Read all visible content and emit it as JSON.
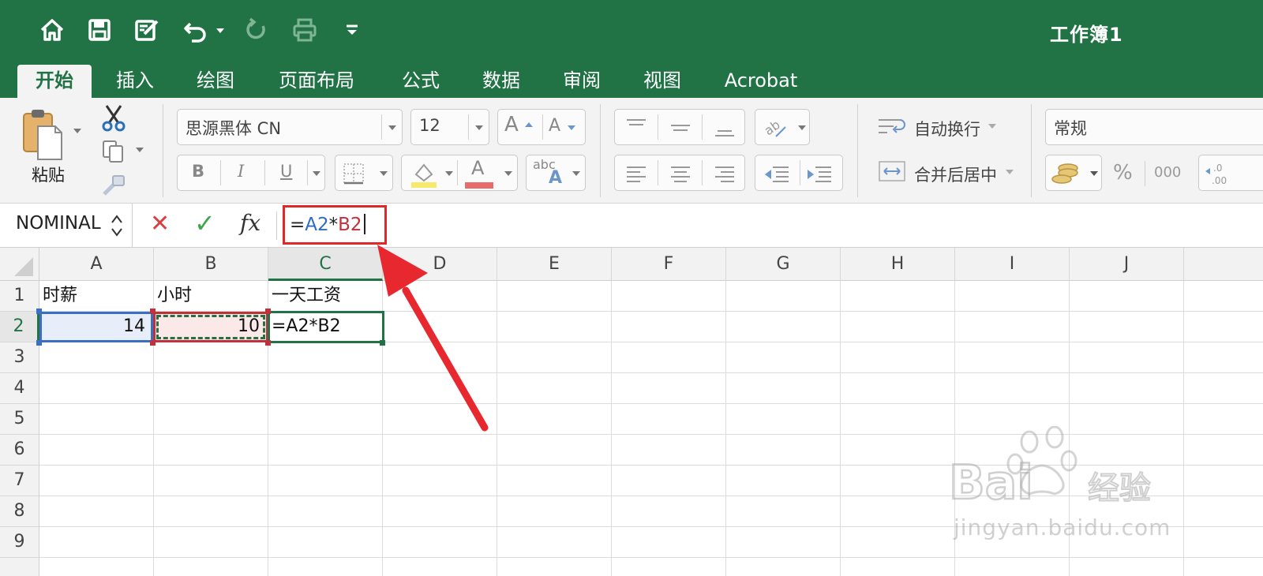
{
  "window": {
    "title": "工作簿1"
  },
  "quick_access": [
    "home-icon",
    "save-icon",
    "edit-icon",
    "undo-icon",
    "redo-icon",
    "print-icon",
    "customize-icon"
  ],
  "tabs": [
    {
      "label": "开始",
      "active": true
    },
    {
      "label": "插入"
    },
    {
      "label": "绘图"
    },
    {
      "label": "页面布局"
    },
    {
      "label": "公式"
    },
    {
      "label": "数据"
    },
    {
      "label": "审阅"
    },
    {
      "label": "视图"
    },
    {
      "label": "Acrobat"
    }
  ],
  "ribbon": {
    "paste_label": "粘贴",
    "font_name": "思源黑体 CN",
    "font_size": "12",
    "grow_font": "A",
    "shrink_font": "A",
    "bold": "B",
    "italic": "I",
    "underline": "U",
    "font_color_letter": "A",
    "abc_label": "abc",
    "wrap_text": "自动换行",
    "merge_center": "合并后居中",
    "number_format": "常规",
    "percent": "%",
    "thousands": "000",
    "colors": {
      "fill_swatch": "#f7e96b",
      "font_swatch": "#e86b6b"
    }
  },
  "formula_bar": {
    "name_box": "NOMINAL",
    "cancel": "✕",
    "enter": "✓",
    "fx": "fx",
    "formula": {
      "eq": "=",
      "ref_a": "A2",
      "op": "*",
      "ref_b": "B2"
    }
  },
  "sheet": {
    "columns": [
      "A",
      "B",
      "C",
      "D",
      "E",
      "F",
      "G",
      "H",
      "I",
      "J"
    ],
    "rows": [
      "1",
      "2",
      "3",
      "4",
      "5",
      "6",
      "7",
      "8",
      "9"
    ],
    "cells": {
      "A1": "时薪",
      "B1": "小时",
      "C1": "一天工资",
      "A2": "14",
      "B2": "10",
      "C2": "=A2*B2"
    }
  },
  "watermark": {
    "text": "jingyan.baidu.com"
  },
  "colors": {
    "brand": "#217346",
    "ref_a": "#2e6bc6",
    "ref_b": "#c0323b",
    "highlight": "#e02828"
  }
}
